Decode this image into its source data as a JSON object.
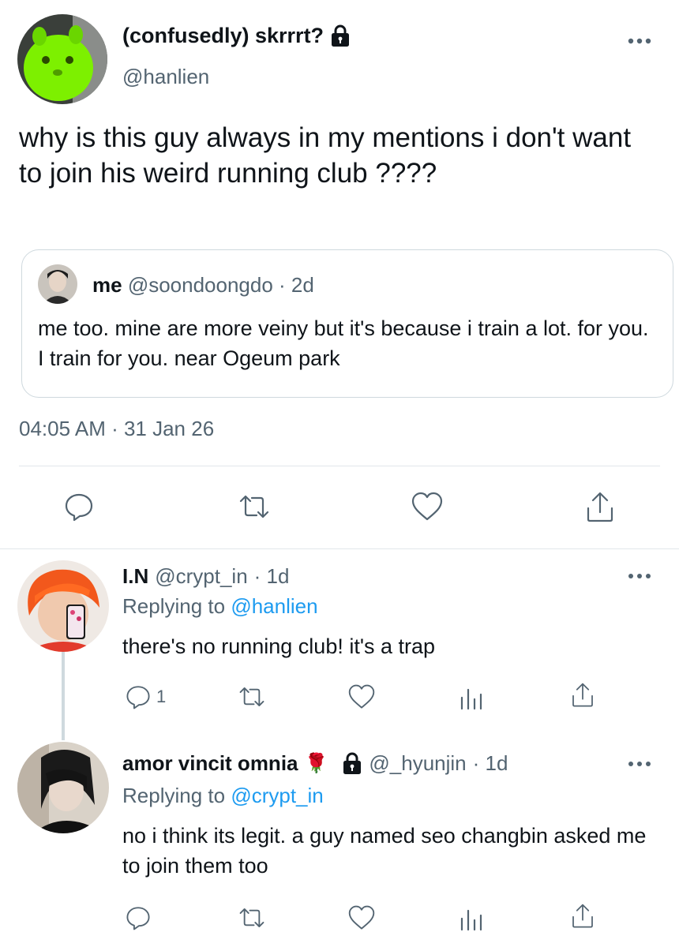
{
  "main_tweet": {
    "display_name": "(confusedly) skrrrt?",
    "handle": "@hanlien",
    "text": "why is this guy always in my mentions i don't want to join his weird running club ????",
    "timestamp": "04:05 AM · 31 Jan 26",
    "quote": {
      "display_name": "me",
      "handle": "@soondoongdo",
      "time": "· 2d",
      "text": "me too. mine are more veiny but it's because i train a lot. for you. I train for you. near Ogeum park"
    },
    "actions": [
      "reply-icon",
      "retweet-icon",
      "like-icon",
      "share-icon"
    ]
  },
  "replies": [
    {
      "display_name": "I.N",
      "handle": "@crypt_in",
      "time": "· 1d",
      "replying_prefix": "Replying to",
      "replying_to": "@hanlien",
      "text": "there's no running club! it's a trap",
      "reply_count": "1"
    },
    {
      "display_name": "amor vincit omnia",
      "emoji": "🌹",
      "handle": "@_hyunjin",
      "time": "· 1d",
      "replying_prefix": "Replying to",
      "replying_to": "@crypt_in",
      "text": "no i think its legit. a guy named seo changbin asked me to join them too"
    }
  ],
  "colors": {
    "link": "#1d9bf0",
    "secondary_text": "#536471",
    "border": "#cfd9de"
  }
}
